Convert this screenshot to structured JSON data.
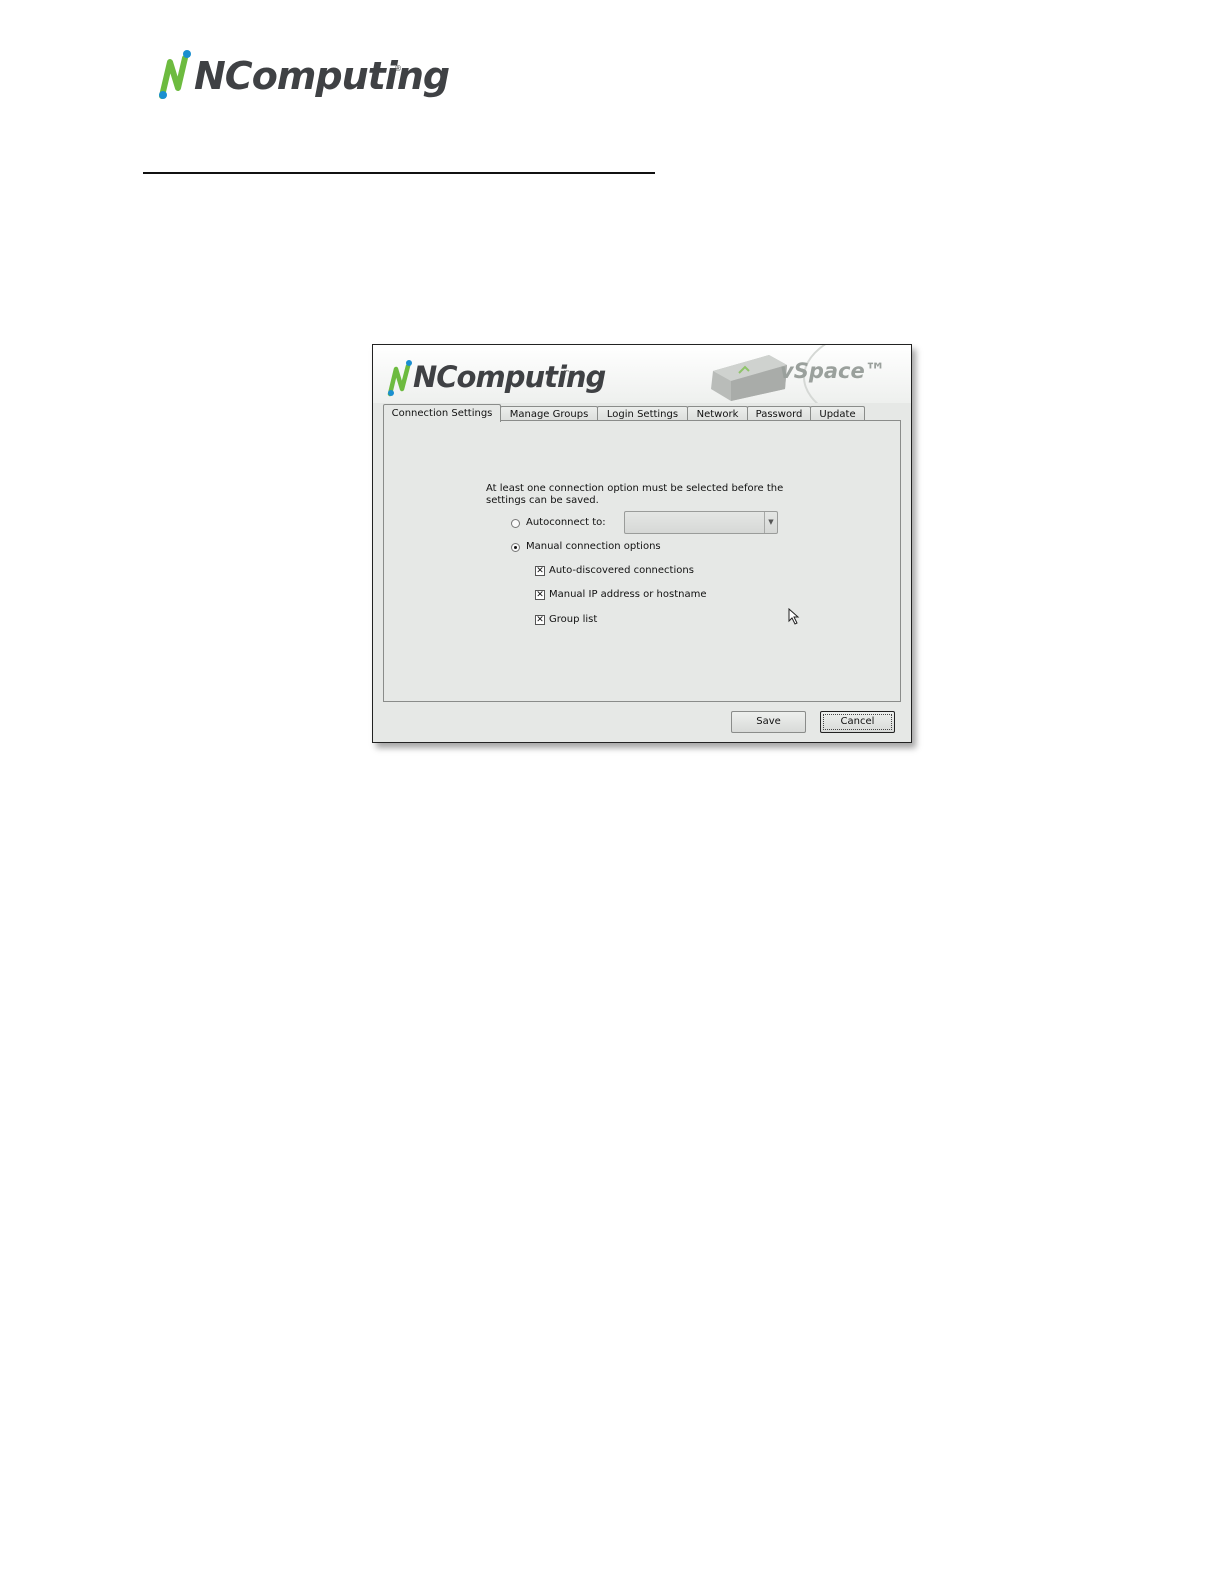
{
  "page": {
    "logo": {
      "icon": "ncomputing-n-logo",
      "text": "NComputing",
      "reg_mark": "®"
    }
  },
  "window": {
    "banner": {
      "logo_text": "NComputing",
      "tm": "™",
      "product": "vSpace™",
      "device_icon": "ncomputing-device"
    },
    "tabs": [
      {
        "label": "Connection Settings",
        "active": true
      },
      {
        "label": "Manage Groups",
        "active": false
      },
      {
        "label": "Login Settings",
        "active": false
      },
      {
        "label": "Network",
        "active": false
      },
      {
        "label": "Password",
        "active": false
      },
      {
        "label": "Update",
        "active": false
      }
    ],
    "notice": "At least one connection option must be selected before the settings can be saved.",
    "autoconnect": {
      "label": "Autoconnect to:",
      "selected": false,
      "value": ""
    },
    "manual": {
      "label": "Manual connection options",
      "selected": true,
      "options": [
        {
          "label": "Auto-discovered connections",
          "checked": true
        },
        {
          "label": "Manual IP address or hostname",
          "checked": true
        },
        {
          "label": "Group list",
          "checked": true
        }
      ]
    },
    "buttons": {
      "save": "Save",
      "cancel": "Cancel"
    }
  },
  "colors": {
    "logo_green": "#6dbb3f",
    "logo_blue": "#1a8fd0",
    "logo_gray": "#3f4144"
  }
}
